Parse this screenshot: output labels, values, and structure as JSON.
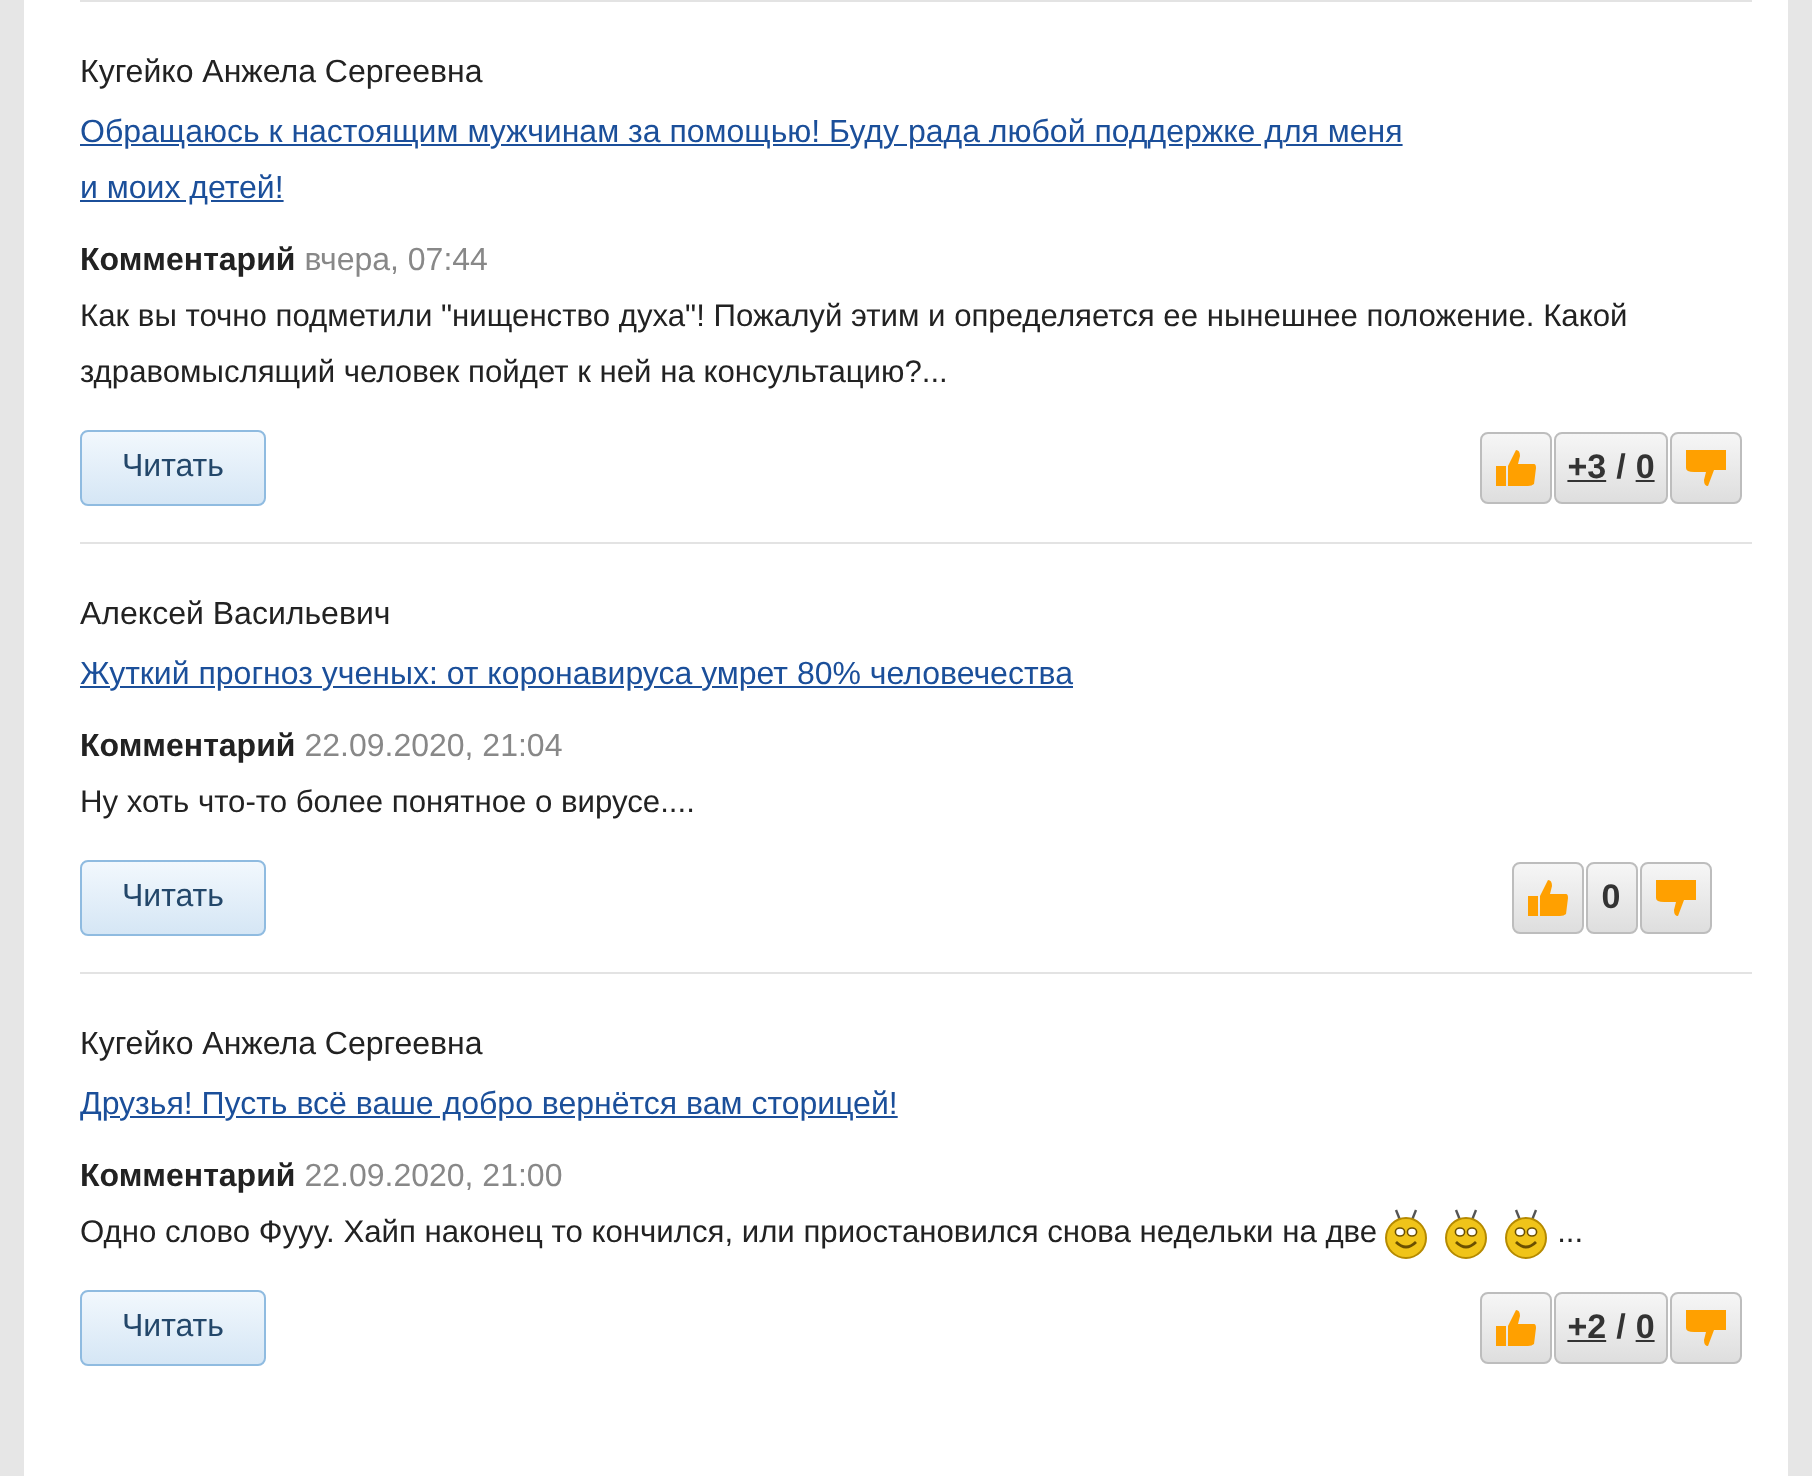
{
  "entries": [
    {
      "author": "Кугейко Анжела Сергеевна",
      "title": "Обращаюсь к настоящим мужчинам за помощью! Буду рада любой поддержке для меня и моих детей!",
      "comment_label": "Комментарий",
      "date": "вчера, 07:44",
      "text": "Как вы точно подметили \"нищенство духа\"! Пожалуй этим и определяется ее нынешнее положение. Какой здравомыслящий человек пойдет к ней на консультацию?...",
      "read_button": "Читать",
      "votes": {
        "kind": "split",
        "up": "+3",
        "separator": "/",
        "down": "0"
      }
    },
    {
      "author": "Алексей Васильевич",
      "title": "Жуткий прогноз ученых: от коронавируса умрет 80% человечества",
      "comment_label": "Комментарий",
      "date": "22.09.2020, 21:04",
      "text": "Ну хоть что-то более понятное о вирусе....",
      "read_button": "Читать",
      "votes": {
        "kind": "total",
        "total": "0"
      }
    },
    {
      "author": "Кугейко Анжела Сергеевна",
      "title": "Друзья! Пусть всё ваше добро вернётся вам сторицей!",
      "comment_label": "Комментарий",
      "date": "22.09.2020, 21:00",
      "text": "Одно слово Фууу. Хайп наконец то кончился, или приостановился снова недельки на две",
      "emoticons": [
        {
          "kind": "smiley"
        },
        {
          "kind": "smiley"
        },
        {
          "kind": "smiley"
        }
      ],
      "text_tail": "...",
      "read_button": "Читать",
      "votes": {
        "kind": "split",
        "up": "+2",
        "separator": "/",
        "down": "0"
      }
    }
  ]
}
